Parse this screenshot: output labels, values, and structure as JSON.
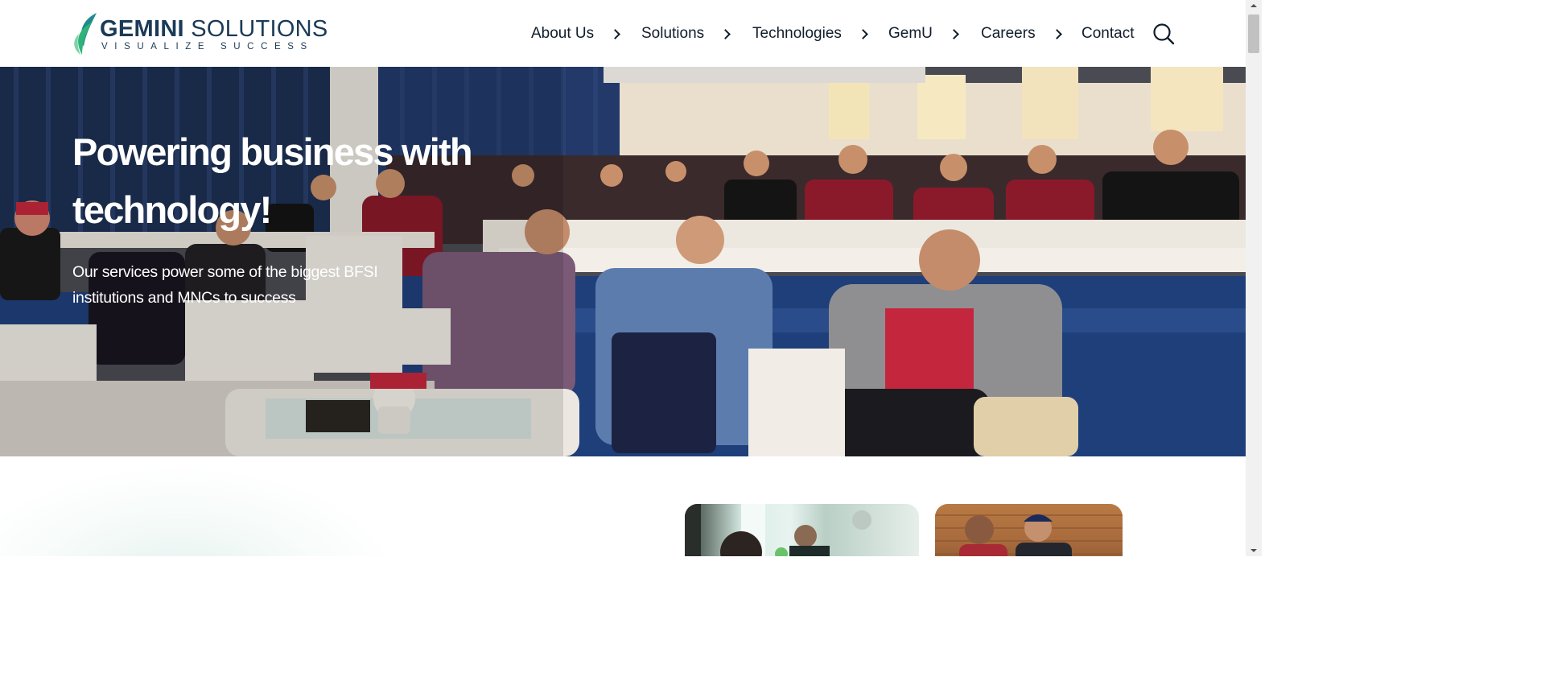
{
  "brand": {
    "name_bold": "GEMINI",
    "name_light": " SOLUTIONS",
    "tagline": "VISUALIZE SUCCESS"
  },
  "nav": {
    "items": [
      {
        "label": "About Us",
        "has_submenu": true
      },
      {
        "label": "Solutions",
        "has_submenu": true
      },
      {
        "label": "Technologies",
        "has_submenu": true
      },
      {
        "label": "GemU",
        "has_submenu": true
      },
      {
        "label": "Careers",
        "has_submenu": true
      },
      {
        "label": "Contact",
        "has_submenu": false
      }
    ],
    "search_icon": "search-icon"
  },
  "hero": {
    "title": "Powering business with technology!",
    "subtitle": "Our services power some of the biggest BFSI institutions and MNCs to success"
  },
  "colors": {
    "brand_navy": "#1b3a57",
    "nav_text": "#111d2b",
    "logo_green": "#2fb37a",
    "logo_teal": "#1f8a8c"
  }
}
